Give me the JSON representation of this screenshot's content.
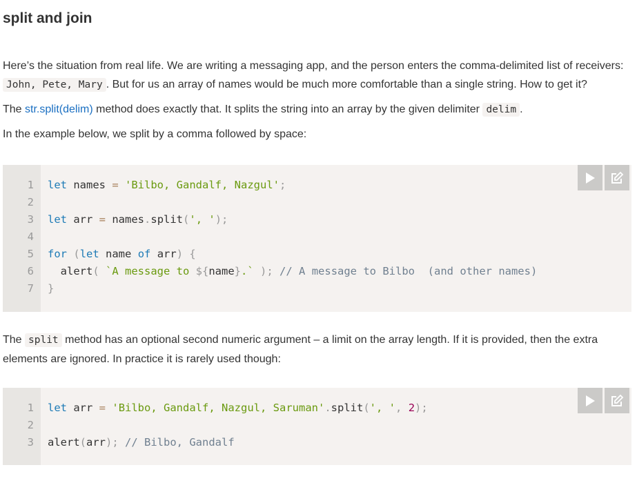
{
  "heading": "split and join",
  "para1": {
    "a": "Here’s the situation from real life. We are writing a messaging app, and the person enters the comma-delimited list of receivers: ",
    "code": "John, Pete, Mary",
    "b": ". But for us an array of names would be much more comfortable than a single string. How to get it?"
  },
  "para2": {
    "a": "The ",
    "link": "str.split(delim)",
    "b": " method does exactly that. It splits the string into an array by the given delimiter ",
    "code": "delim",
    "c": "."
  },
  "para3": "In the example below, we split by a comma followed by space:",
  "code1": {
    "lines": [
      [
        {
          "t": "let",
          "c": "kw"
        },
        {
          "t": " names ",
          "c": "txt"
        },
        {
          "t": "=",
          "c": "op"
        },
        {
          "t": " ",
          "c": "txt"
        },
        {
          "t": "'Bilbo, Gandalf, Nazgul'",
          "c": "str"
        },
        {
          "t": ";",
          "c": "pun"
        }
      ],
      [],
      [
        {
          "t": "let",
          "c": "kw"
        },
        {
          "t": " arr ",
          "c": "txt"
        },
        {
          "t": "=",
          "c": "op"
        },
        {
          "t": " names",
          "c": "txt"
        },
        {
          "t": ".",
          "c": "pun"
        },
        {
          "t": "split",
          "c": "txt"
        },
        {
          "t": "(",
          "c": "pun"
        },
        {
          "t": "', '",
          "c": "str"
        },
        {
          "t": ");",
          "c": "pun"
        }
      ],
      [],
      [
        {
          "t": "for",
          "c": "kw"
        },
        {
          "t": " ",
          "c": "txt"
        },
        {
          "t": "(",
          "c": "pun"
        },
        {
          "t": "let",
          "c": "kw"
        },
        {
          "t": " name ",
          "c": "txt"
        },
        {
          "t": "of",
          "c": "kw"
        },
        {
          "t": " arr",
          "c": "txt"
        },
        {
          "t": ")",
          "c": "pun"
        },
        {
          "t": " ",
          "c": "txt"
        },
        {
          "t": "{",
          "c": "pun"
        }
      ],
      [
        {
          "t": "  alert",
          "c": "txt"
        },
        {
          "t": "(",
          "c": "pun"
        },
        {
          "t": " ",
          "c": "txt"
        },
        {
          "t": "`A message to ",
          "c": "str"
        },
        {
          "t": "${",
          "c": "pun"
        },
        {
          "t": "name",
          "c": "txt"
        },
        {
          "t": "}",
          "c": "pun"
        },
        {
          "t": ".`",
          "c": "str"
        },
        {
          "t": " ",
          "c": "txt"
        },
        {
          "t": ");",
          "c": "pun"
        },
        {
          "t": " // A message to Bilbo  (and other names)",
          "c": "com"
        }
      ],
      [
        {
          "t": "}",
          "c": "pun"
        }
      ]
    ]
  },
  "para4": {
    "a": "The ",
    "code": "split",
    "b": " method has an optional second numeric argument – a limit on the array length. If it is provided, then the extra elements are ignored. In practice it is rarely used though:"
  },
  "code2": {
    "lines": [
      [
        {
          "t": "let",
          "c": "kw"
        },
        {
          "t": " arr ",
          "c": "txt"
        },
        {
          "t": "=",
          "c": "op"
        },
        {
          "t": " ",
          "c": "txt"
        },
        {
          "t": "'Bilbo, Gandalf, Nazgul, Saruman'",
          "c": "str"
        },
        {
          "t": ".",
          "c": "pun"
        },
        {
          "t": "split",
          "c": "txt"
        },
        {
          "t": "(",
          "c": "pun"
        },
        {
          "t": "', '",
          "c": "str"
        },
        {
          "t": ",",
          "c": "pun"
        },
        {
          "t": " ",
          "c": "txt"
        },
        {
          "t": "2",
          "c": "num"
        },
        {
          "t": ");",
          "c": "pun"
        }
      ],
      [],
      [
        {
          "t": "alert",
          "c": "txt"
        },
        {
          "t": "(",
          "c": "pun"
        },
        {
          "t": "arr",
          "c": "txt"
        },
        {
          "t": ");",
          "c": "pun"
        },
        {
          "t": " // Bilbo, Gandalf",
          "c": "com"
        }
      ]
    ]
  },
  "icons": {
    "run": "play-icon",
    "edit": "edit-icon"
  }
}
